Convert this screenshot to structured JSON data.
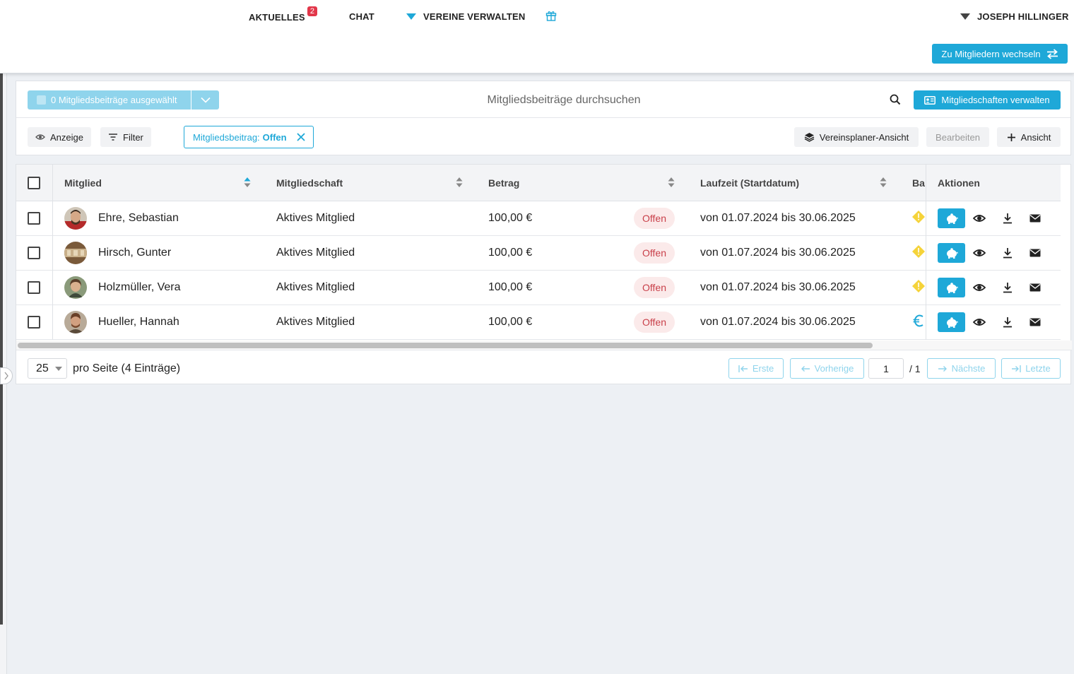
{
  "nav": {
    "news_label": "AKTUELLES",
    "news_badge": "2",
    "chat_label": "CHAT",
    "clubs_label": "VEREINE VERWALTEN",
    "user_label": "JOSEPH HILLINGER",
    "switch_label": "Zu Mitgliedern wechseln"
  },
  "toolbar": {
    "selected_label": "0 Mitgliedsbeiträge ausgewählt",
    "search_placeholder": "Mitgliedsbeiträge durchsuchen",
    "manage_label": "Mitgliedschaften verwalten",
    "view_label": "Anzeige",
    "filter_label": "Filter",
    "filter_tag_key": "Mitgliedsbeitrag:",
    "filter_tag_value": "Offen",
    "planner_view_label": "Vereinsplaner-Ansicht",
    "edit_label": "Bearbeiten",
    "add_view_label": "Ansicht"
  },
  "table": {
    "columns": {
      "member": "Mitglied",
      "membership": "Mitgliedschaft",
      "amount": "Betrag",
      "period": "Laufzeit (Startdatum)",
      "ba": "Ba",
      "actions": "Aktionen"
    },
    "rows": [
      {
        "name": "Ehre, Sebastian",
        "membership": "Aktives Mitglied",
        "amount": "100,00 €",
        "status": "Offen",
        "period": "von 01.07.2024 bis 30.06.2025",
        "ba_icon": "warning-icon"
      },
      {
        "name": "Hirsch, Gunter",
        "membership": "Aktives Mitglied",
        "amount": "100,00 €",
        "status": "Offen",
        "period": "von 01.07.2024 bis 30.06.2025",
        "ba_icon": "warning-icon"
      },
      {
        "name": "Holzmüller, Vera",
        "membership": "Aktives Mitglied",
        "amount": "100,00 €",
        "status": "Offen",
        "period": "von 01.07.2024 bis 30.06.2025",
        "ba_icon": "warning-icon"
      },
      {
        "name": "Hueller, Hannah",
        "membership": "Aktives Mitglied",
        "amount": "100,00 €",
        "status": "Offen",
        "period": "von 01.07.2024 bis 30.06.2025",
        "ba_icon": "euro-icon"
      }
    ]
  },
  "pagination": {
    "per_page": "25",
    "per_page_label": "pro Seite (4 Einträge)",
    "first": "Erste",
    "prev": "Vorherige",
    "page": "1",
    "total": "/ 1",
    "next": "Nächste",
    "last": "Letzte"
  },
  "colors": {
    "accent": "#1ea8d8",
    "accent_light": "#8fd4ec",
    "badge_red": "#e2374a",
    "status_text": "#c9404a",
    "status_bg": "#fbeaea",
    "warning": "#f5d33a"
  }
}
